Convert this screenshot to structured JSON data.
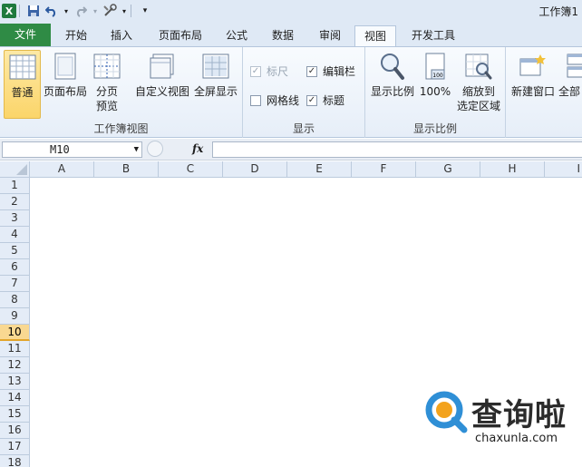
{
  "window": {
    "title": "工作簿1"
  },
  "tabs": [
    "文件",
    "开始",
    "插入",
    "页面布局",
    "公式",
    "数据",
    "审阅",
    "视图",
    "开发工具"
  ],
  "ribbon": {
    "workbook_views": {
      "label": "工作簿视图",
      "normal": "普通",
      "page_layout": "页面布局",
      "page_break_1": "分页",
      "page_break_2": "预览",
      "custom_views": "自定义视图",
      "full_screen": "全屏显示"
    },
    "show": {
      "label": "显示",
      "ruler": "标尺",
      "formula_bar": "编辑栏",
      "gridlines": "网格线",
      "headings": "标题"
    },
    "zoom": {
      "label": "显示比例",
      "zoom": "显示比例",
      "zoom100": "100%",
      "zoom_sel_1": "缩放到",
      "zoom_sel_2": "选定区域"
    },
    "window": {
      "new_window": "新建窗口",
      "arrange_all": "全部"
    }
  },
  "formula_bar": {
    "name_box": "M10",
    "fx": "fx",
    "value": ""
  },
  "columns": [
    "A",
    "B",
    "C",
    "D",
    "E",
    "F",
    "G",
    "H",
    "I"
  ],
  "rows": [
    "1",
    "2",
    "3",
    "4",
    "5",
    "6",
    "7",
    "8",
    "9",
    "10",
    "11",
    "12",
    "13",
    "14",
    "15",
    "16",
    "17",
    "18"
  ],
  "selected_row": "10",
  "watermark": {
    "name": "查询啦",
    "url": "chaxunla.com"
  }
}
